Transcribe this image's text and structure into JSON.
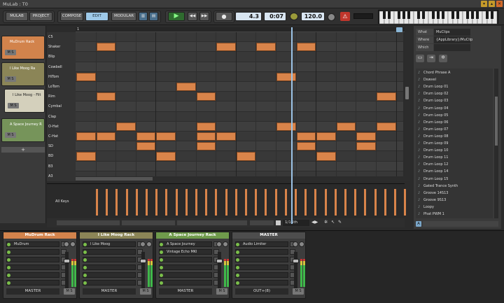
{
  "window": {
    "title": "MuLab : T0",
    "controls": [
      "▾",
      "▴",
      "✕"
    ]
  },
  "toolbar": {
    "mulab": "MULAB",
    "project": "PROJECT",
    "compose": "COMPOSE",
    "edit": "EDIT",
    "modular": "MODULAR",
    "position": "4.3",
    "time": "0:07",
    "tempo": "120.0"
  },
  "tracks": [
    {
      "name": "MuDrum Rack",
      "color": "#d2834c",
      "ms": "M S"
    },
    {
      "name": "I Like Moog Ra",
      "color": "#8b8557",
      "ms": "M S"
    },
    {
      "name": "I Like Moog - Filt",
      "color": "#d4d0bc",
      "ms": "M S"
    },
    {
      "name": "A Space Journey R",
      "color": "#76945a",
      "ms": "M S"
    }
  ],
  "track_add": "+",
  "editor": {
    "ruler_mark": "1",
    "keys": [
      "C5",
      "Shaker",
      "Blip",
      "Cowbell",
      "HiTom",
      "LoTom",
      "Rim",
      "Cymbal",
      "Clap",
      "O-Hat",
      "C-Hat",
      "SD",
      "BD",
      "B3",
      "A3"
    ],
    "velocity_label": "All Keys",
    "quantize": "1/16th",
    "note_color": "#d9844a"
  },
  "browser": {
    "what_label": "What",
    "what_value": "MuClips",
    "where_label": "Where",
    "where_value": "{AppLibrary}/MuClip",
    "which_label": "Which",
    "which_value": "",
    "items": [
      "Chord Phrase A",
      "Dswvel",
      "Drum Loop 01",
      "Drum Loop 02",
      "Drum Loop 03",
      "Drum Loop 04",
      "Drum Loop 05",
      "Drum Loop 06",
      "Drum Loop 07",
      "Drum Loop 08",
      "Drum Loop 09",
      "Drum Loop 10",
      "Drum Loop 11",
      "Drum Loop 12",
      "Drum Loop 14",
      "Drum Loop 15",
      "Gated Trance Synth",
      "Groove 14S13",
      "Groove 9S13",
      "Loopy",
      "Phat PWM 1"
    ],
    "footer": "A"
  },
  "mixer": [
    {
      "name": "MuDrum Rack",
      "color": "#d2834c",
      "slots": [
        "MuDrum",
        "",
        "",
        "",
        "",
        ""
      ],
      "out": "MASTER"
    },
    {
      "name": "I Like Moog Rack",
      "color": "#8b8557",
      "slots": [
        "I Like Moog",
        "",
        "",
        "",
        "",
        ""
      ],
      "out": "MASTER"
    },
    {
      "name": "A Space Journey Rack",
      "color": "#6f9a4b",
      "slots": [
        "A Space Journey",
        "Vintage Echo MKI",
        "",
        "",
        "",
        ""
      ],
      "out": "MASTER"
    },
    {
      "name": "MASTER",
      "color": "#4d4d4d",
      "slots": [
        "Audio Limiter",
        "",
        "",
        "",
        "",
        ""
      ],
      "out": "OUT+(8)"
    }
  ]
}
